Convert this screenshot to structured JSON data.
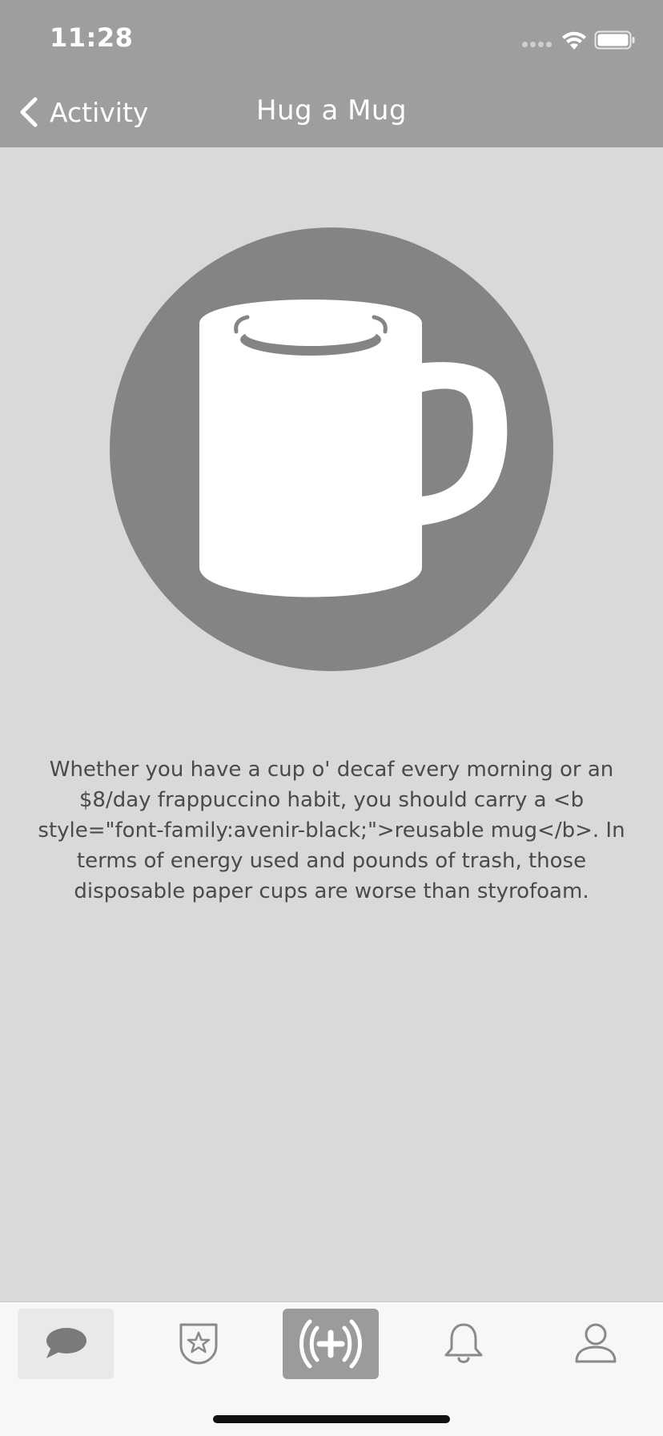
{
  "status_bar": {
    "time": "11:28"
  },
  "nav": {
    "back_label": "Activity",
    "title": "Hug a Mug"
  },
  "hero": {
    "icon": "mug-icon",
    "circle_color": "#848484"
  },
  "description": "Whether you have a cup o' decaf every morning or an $8/day frappuccino habit, you should carry a <b style=\"font-family:avenir-black;\">reusable mug</b>. In terms of energy used and pounds of trash, those disposable paper cups are worse than styrofoam.",
  "tabs": [
    {
      "icon": "chat-bubble-icon",
      "selected": true
    },
    {
      "icon": "star-badge-icon",
      "selected": false
    },
    {
      "icon": "broadcast-plus-icon",
      "selected": false
    },
    {
      "icon": "bell-icon",
      "selected": false
    },
    {
      "icon": "person-icon",
      "selected": false
    }
  ],
  "colors": {
    "header": "#9e9e9e",
    "background": "#d9d9d9",
    "tab_bar": "#f7f7f7",
    "action_tab": "#9b9b9b"
  }
}
